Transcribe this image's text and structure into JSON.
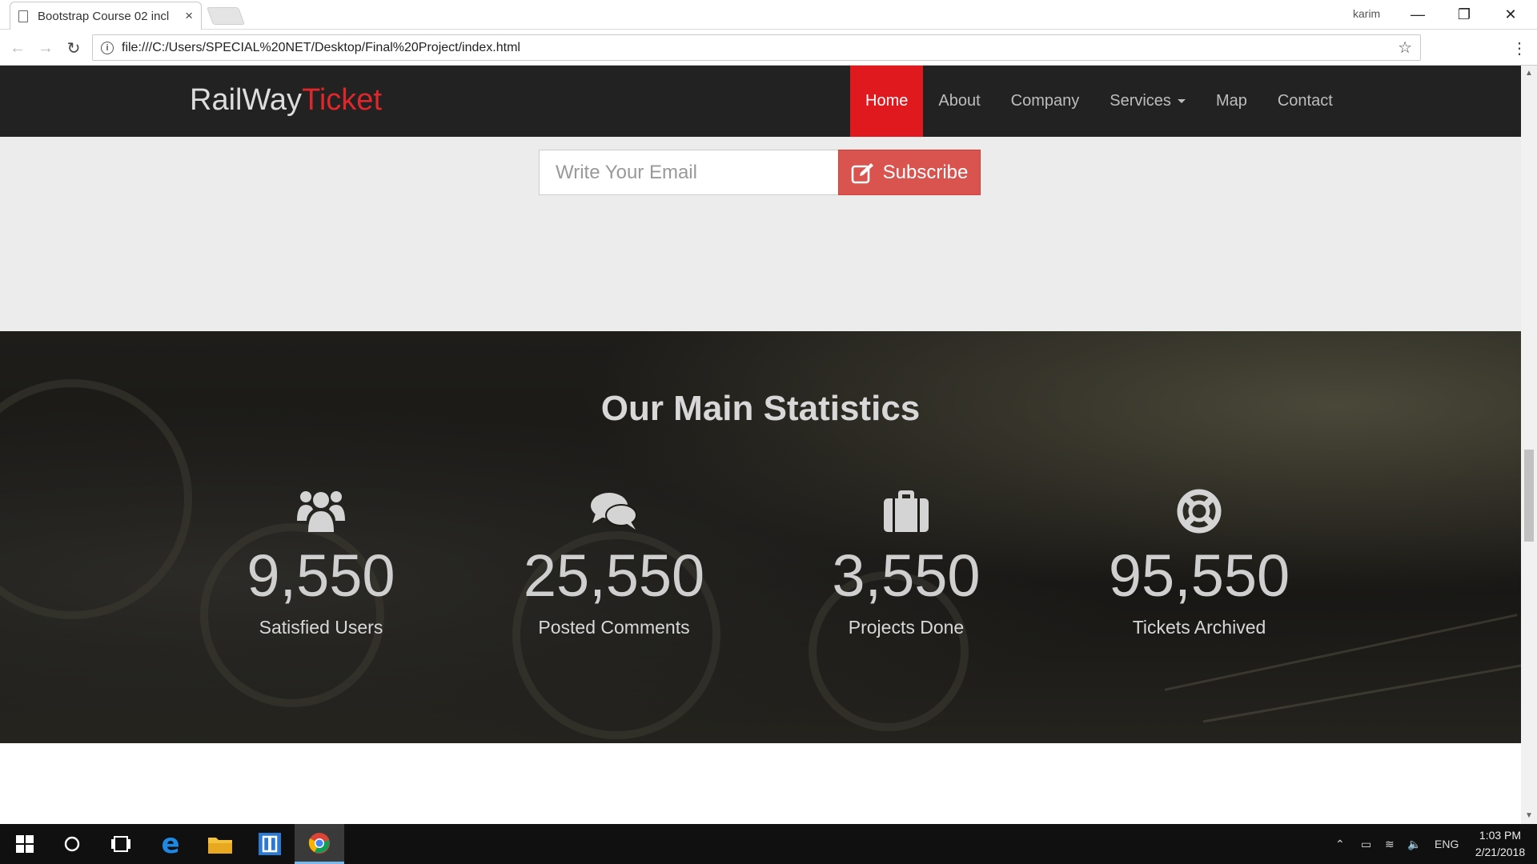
{
  "browser": {
    "tab_title": "Bootstrap Course 02 incl",
    "user_label": "karim",
    "url": "file:///C:/Users/SPECIAL%20NET/Desktop/Final%20Project/index.html"
  },
  "navbar": {
    "brand_part1": "RailWay",
    "brand_part2": "Ticket",
    "items": [
      {
        "label": "Home",
        "active": true
      },
      {
        "label": "About"
      },
      {
        "label": "Company"
      },
      {
        "label": "Services",
        "dropdown": true
      },
      {
        "label": "Map"
      },
      {
        "label": "Contact"
      }
    ]
  },
  "subscribe": {
    "placeholder": "Write Your Email",
    "button_label": "Subscribe"
  },
  "stats": {
    "title": "Our Main Statistics",
    "items": [
      {
        "icon": "users-icon",
        "value": "9,550",
        "label": "Satisfied Users"
      },
      {
        "icon": "comments-icon",
        "value": "25,550",
        "label": "Posted Comments"
      },
      {
        "icon": "briefcase-icon",
        "value": "3,550",
        "label": "Projects Done"
      },
      {
        "icon": "life-ring-icon",
        "value": "95,550",
        "label": "Tickets Archived"
      }
    ]
  },
  "taskbar": {
    "language": "ENG",
    "time": "1:03 PM",
    "date": "2/21/2018"
  },
  "colors": {
    "accent_red": "#e0191f",
    "brand_red": "#e0262b",
    "subscribe_button": "#d9534f",
    "navbar_bg": "#222222"
  }
}
